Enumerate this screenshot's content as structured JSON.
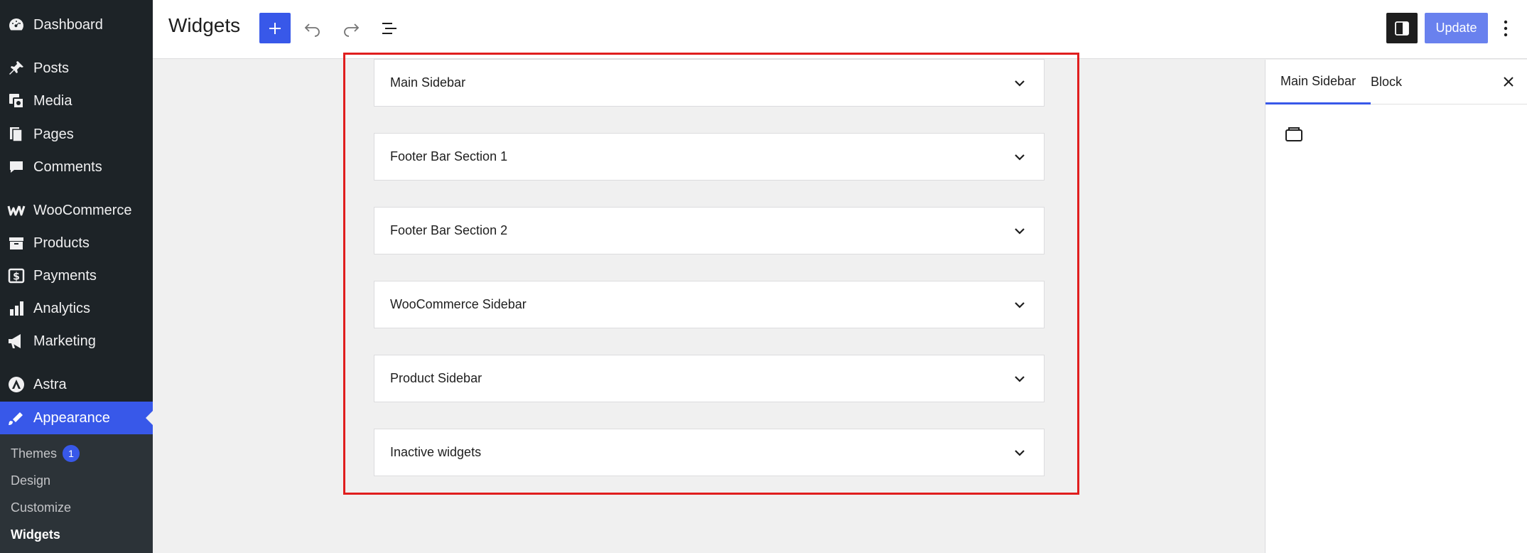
{
  "sidebar": {
    "items": [
      {
        "label": "Dashboard",
        "icon": "dashboard-icon"
      },
      {
        "label": "Posts",
        "icon": "pin-icon"
      },
      {
        "label": "Media",
        "icon": "media-icon"
      },
      {
        "label": "Pages",
        "icon": "pages-icon"
      },
      {
        "label": "Comments",
        "icon": "comment-icon"
      },
      {
        "label": "WooCommerce",
        "icon": "woocommerce-icon"
      },
      {
        "label": "Products",
        "icon": "archive-icon"
      },
      {
        "label": "Payments",
        "icon": "dollar-icon"
      },
      {
        "label": "Analytics",
        "icon": "bar-chart-icon"
      },
      {
        "label": "Marketing",
        "icon": "megaphone-icon"
      },
      {
        "label": "Astra",
        "icon": "astra-icon"
      },
      {
        "label": "Appearance",
        "icon": "paintbrush-icon"
      }
    ],
    "submenu": [
      {
        "label": "Themes",
        "badge": "1"
      },
      {
        "label": "Design"
      },
      {
        "label": "Customize"
      },
      {
        "label": "Widgets"
      }
    ]
  },
  "toolbar": {
    "title": "Widgets",
    "update_label": "Update"
  },
  "widget_areas": [
    {
      "title": "Main Sidebar"
    },
    {
      "title": "Footer Bar Section 1"
    },
    {
      "title": "Footer Bar Section 2"
    },
    {
      "title": "WooCommerce Sidebar"
    },
    {
      "title": "Product Sidebar"
    },
    {
      "title": "Inactive widgets"
    }
  ],
  "panel": {
    "tabs": [
      "Main Sidebar",
      "Block"
    ]
  },
  "colors": {
    "accent": "#3858e9",
    "sidebar_bg": "#1d2327",
    "highlight": "#e01e1e"
  }
}
